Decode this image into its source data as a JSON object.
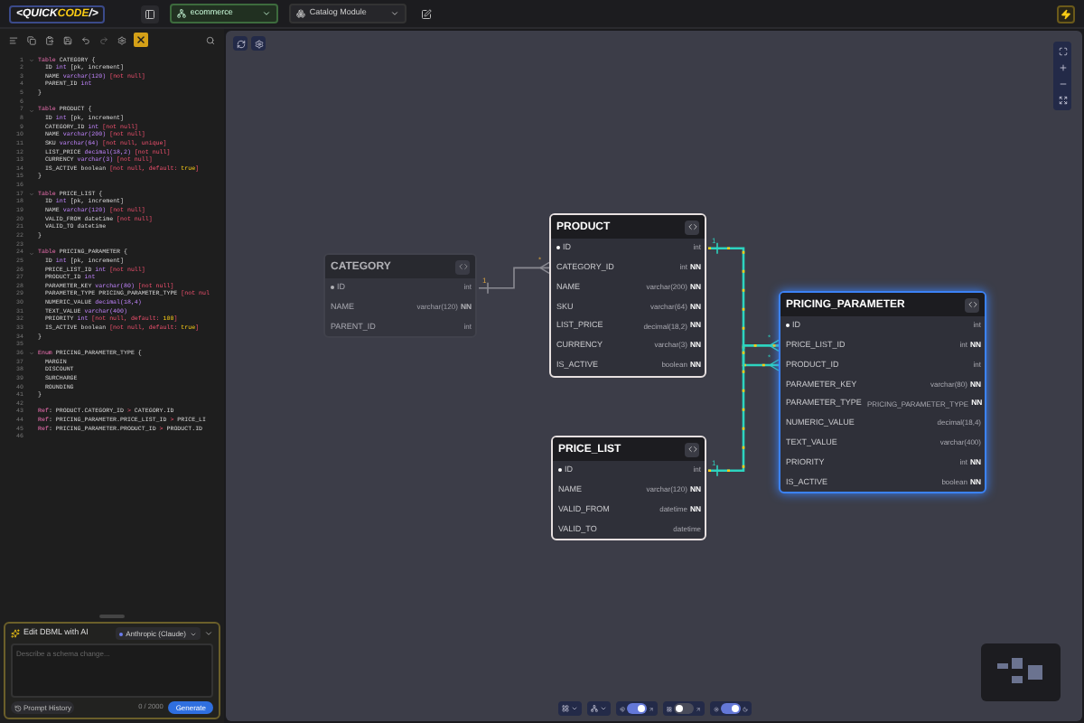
{
  "topbar": {
    "logo": [
      {
        "text": "<",
        "accent": false
      },
      {
        "text": "QUICK",
        "accent": false
      },
      {
        "text": "CODE",
        "accent": true
      },
      {
        "text": "/>",
        "accent": false
      }
    ],
    "project": {
      "value": "ecommerce"
    },
    "module": {
      "value": "Catalog Module"
    }
  },
  "editor": {
    "ai_active": true,
    "lines": [
      {
        "n": "1",
        "fold": true,
        "segs": [
          {
            "kind": "k",
            "text": "Table"
          },
          {
            "kind": "p",
            "text": " CATEGORY {"
          }
        ]
      },
      {
        "n": "2",
        "fold": false,
        "segs": [
          {
            "kind": "p",
            "text": "  ID "
          },
          {
            "kind": "t",
            "text": "int"
          },
          {
            "kind": "p",
            "text": " [pk, increment]"
          }
        ]
      },
      {
        "n": "3",
        "fold": false,
        "segs": [
          {
            "kind": "p",
            "text": "  NAME "
          },
          {
            "kind": "t",
            "text": "varchar(120)"
          },
          {
            "kind": "m",
            "text": " [not null]"
          }
        ]
      },
      {
        "n": "4",
        "fold": false,
        "segs": [
          {
            "kind": "p",
            "text": "  PARENT_ID "
          },
          {
            "kind": "t",
            "text": "int"
          }
        ]
      },
      {
        "n": "5",
        "fold": false,
        "segs": [
          {
            "kind": "p",
            "text": "}"
          }
        ]
      },
      {
        "n": "6",
        "fold": false
      },
      {
        "n": "7",
        "fold": true,
        "segs": [
          {
            "kind": "k",
            "text": "Table"
          },
          {
            "kind": "p",
            "text": " PRODUCT {"
          }
        ]
      },
      {
        "n": "8",
        "fold": false,
        "segs": [
          {
            "kind": "p",
            "text": "  ID "
          },
          {
            "kind": "t",
            "text": "int"
          },
          {
            "kind": "p",
            "text": " [pk, increment]"
          }
        ]
      },
      {
        "n": "9",
        "fold": false,
        "segs": [
          {
            "kind": "p",
            "text": "  CATEGORY_ID "
          },
          {
            "kind": "t",
            "text": "int"
          },
          {
            "kind": "m",
            "text": " [not null]"
          }
        ]
      },
      {
        "n": "10",
        "fold": false,
        "segs": [
          {
            "kind": "p",
            "text": "  NAME "
          },
          {
            "kind": "t",
            "text": "varchar(200)"
          },
          {
            "kind": "m",
            "text": " [not null]"
          }
        ]
      },
      {
        "n": "11",
        "fold": false,
        "segs": [
          {
            "kind": "p",
            "text": "  SKU "
          },
          {
            "kind": "t",
            "text": "varchar(64)"
          },
          {
            "kind": "m",
            "text": " [not null, unique]"
          }
        ]
      },
      {
        "n": "12",
        "fold": false,
        "segs": [
          {
            "kind": "p",
            "text": "  LIST_PRICE "
          },
          {
            "kind": "t",
            "text": "decimal(18,2)"
          },
          {
            "kind": "m",
            "text": " [not null]"
          }
        ]
      },
      {
        "n": "13",
        "fold": false,
        "segs": [
          {
            "kind": "p",
            "text": "  CURRENCY "
          },
          {
            "kind": "t",
            "text": "varchar(3)"
          },
          {
            "kind": "m",
            "text": " [not null]"
          }
        ]
      },
      {
        "n": "14",
        "fold": false,
        "segs": [
          {
            "kind": "p",
            "text": "  IS_ACTIVE boolean "
          },
          {
            "kind": "m",
            "text": "[not null, default: "
          },
          {
            "kind": "l",
            "text": "true"
          },
          {
            "kind": "m",
            "text": "]"
          }
        ]
      },
      {
        "n": "15",
        "fold": false,
        "segs": [
          {
            "kind": "p",
            "text": "}"
          }
        ]
      },
      {
        "n": "16",
        "fold": false
      },
      {
        "n": "17",
        "fold": true,
        "segs": [
          {
            "kind": "k",
            "text": "Table"
          },
          {
            "kind": "p",
            "text": " PRICE_LIST {"
          }
        ]
      },
      {
        "n": "18",
        "fold": false,
        "segs": [
          {
            "kind": "p",
            "text": "  ID "
          },
          {
            "kind": "t",
            "text": "int"
          },
          {
            "kind": "p",
            "text": " [pk, increment]"
          }
        ]
      },
      {
        "n": "19",
        "fold": false,
        "segs": [
          {
            "kind": "p",
            "text": "  NAME "
          },
          {
            "kind": "t",
            "text": "varchar(120)"
          },
          {
            "kind": "m",
            "text": " [not null]"
          }
        ]
      },
      {
        "n": "20",
        "fold": false,
        "segs": [
          {
            "kind": "p",
            "text": "  VALID_FROM datetime "
          },
          {
            "kind": "m",
            "text": "[not null]"
          }
        ]
      },
      {
        "n": "21",
        "fold": false,
        "segs": [
          {
            "kind": "p",
            "text": "  VALID_TO datetime"
          }
        ]
      },
      {
        "n": "22",
        "fold": false,
        "segs": [
          {
            "kind": "p",
            "text": "}"
          }
        ]
      },
      {
        "n": "23",
        "fold": false
      },
      {
        "n": "24",
        "fold": true,
        "segs": [
          {
            "kind": "k",
            "text": "Table"
          },
          {
            "kind": "p",
            "text": " PRICING_PARAMETER {"
          }
        ]
      },
      {
        "n": "25",
        "fold": false,
        "segs": [
          {
            "kind": "p",
            "text": "  ID "
          },
          {
            "kind": "t",
            "text": "int"
          },
          {
            "kind": "p",
            "text": " [pk, increment]"
          }
        ]
      },
      {
        "n": "26",
        "fold": false,
        "segs": [
          {
            "kind": "p",
            "text": "  PRICE_LIST_ID "
          },
          {
            "kind": "t",
            "text": "int"
          },
          {
            "kind": "m",
            "text": " [not null]"
          }
        ]
      },
      {
        "n": "27",
        "fold": false,
        "segs": [
          {
            "kind": "p",
            "text": "  PRODUCT_ID "
          },
          {
            "kind": "t",
            "text": "int"
          }
        ]
      },
      {
        "n": "28",
        "fold": false,
        "segs": [
          {
            "kind": "p",
            "text": "  PARAMETER_KEY "
          },
          {
            "kind": "t",
            "text": "varchar(80)"
          },
          {
            "kind": "m",
            "text": " [not null]"
          }
        ]
      },
      {
        "n": "29",
        "fold": false,
        "segs": [
          {
            "kind": "p",
            "text": "  PARAMETER_TYPE PRICING_PARAMETER_TYPE "
          },
          {
            "kind": "m",
            "text": "[not nul"
          }
        ]
      },
      {
        "n": "30",
        "fold": false,
        "segs": [
          {
            "kind": "p",
            "text": "  NUMERIC_VALUE "
          },
          {
            "kind": "t",
            "text": "decimal(18,4)"
          }
        ]
      },
      {
        "n": "31",
        "fold": false,
        "segs": [
          {
            "kind": "p",
            "text": "  TEXT_VALUE "
          },
          {
            "kind": "t",
            "text": "varchar(400)"
          }
        ]
      },
      {
        "n": "32",
        "fold": false,
        "segs": [
          {
            "kind": "p",
            "text": "  PRIORITY "
          },
          {
            "kind": "t",
            "text": "int"
          },
          {
            "kind": "m",
            "text": " [not null, default: "
          },
          {
            "kind": "l",
            "text": "100"
          },
          {
            "kind": "m",
            "text": "]"
          }
        ]
      },
      {
        "n": "33",
        "fold": false,
        "segs": [
          {
            "kind": "p",
            "text": "  IS_ACTIVE boolean "
          },
          {
            "kind": "m",
            "text": "[not null, default: "
          },
          {
            "kind": "l",
            "text": "true"
          },
          {
            "kind": "m",
            "text": "]"
          }
        ]
      },
      {
        "n": "34",
        "fold": false,
        "segs": [
          {
            "kind": "p",
            "text": "}"
          }
        ]
      },
      {
        "n": "35",
        "fold": false
      },
      {
        "n": "36",
        "fold": true,
        "segs": [
          {
            "kind": "k",
            "text": "Enum"
          },
          {
            "kind": "p",
            "text": " PRICING_PARAMETER_TYPE {"
          }
        ]
      },
      {
        "n": "37",
        "fold": false,
        "segs": [
          {
            "kind": "p",
            "text": "  MARGIN"
          }
        ]
      },
      {
        "n": "38",
        "fold": false,
        "segs": [
          {
            "kind": "p",
            "text": "  DISCOUNT"
          }
        ]
      },
      {
        "n": "39",
        "fold": false,
        "segs": [
          {
            "kind": "p",
            "text": "  SURCHARGE"
          }
        ]
      },
      {
        "n": "40",
        "fold": false,
        "segs": [
          {
            "kind": "p",
            "text": "  ROUNDING"
          }
        ]
      },
      {
        "n": "41",
        "fold": false,
        "segs": [
          {
            "kind": "p",
            "text": "}"
          }
        ]
      },
      {
        "n": "42",
        "fold": false
      },
      {
        "n": "43",
        "fold": false,
        "segs": [
          {
            "kind": "k",
            "text": "Ref"
          },
          {
            "kind": "p",
            "text": ": PRODUCT.CATEGORY_ID "
          },
          {
            "kind": "m",
            "text": ">"
          },
          {
            "kind": "p",
            "text": " CATEGORY.ID"
          }
        ]
      },
      {
        "n": "44",
        "fold": false,
        "segs": [
          {
            "kind": "k",
            "text": "Ref"
          },
          {
            "kind": "p",
            "text": ": PRICING_PARAMETER.PRICE_LIST_ID "
          },
          {
            "kind": "m",
            "text": ">"
          },
          {
            "kind": "p",
            "text": " PRICE_LI"
          }
        ]
      },
      {
        "n": "45",
        "fold": false,
        "segs": [
          {
            "kind": "k",
            "text": "Ref"
          },
          {
            "kind": "p",
            "text": ": PRICING_PARAMETER.PRODUCT_ID "
          },
          {
            "kind": "m",
            "text": ">"
          },
          {
            "kind": "p",
            "text": " PRODUCT.ID"
          }
        ]
      },
      {
        "n": "46",
        "fold": false
      }
    ]
  },
  "ai_panel": {
    "title": "Edit DBML with AI",
    "provider": "Anthropic (Claude)",
    "placeholder": "Describe a schema change...",
    "history_button": "Prompt History",
    "counter": "0 / 2000",
    "generate_button": "Generate"
  },
  "canvas": {
    "tables": [
      {
        "name": "CATEGORY",
        "dimmed": true,
        "selected": false,
        "columns": [
          {
            "name": "ID",
            "type": "int",
            "pk": true
          },
          {
            "name": "NAME",
            "type": "varchar(120)",
            "flag": "NN",
            "pk": false
          },
          {
            "name": "PARENT_ID",
            "type": "int",
            "pk": false
          }
        ]
      },
      {
        "name": "PRODUCT",
        "dimmed": false,
        "selected": false,
        "columns": [
          {
            "name": "ID",
            "type": "int",
            "pk": true
          },
          {
            "name": "CATEGORY_ID",
            "type": "int",
            "flag": "NN",
            "pk": false
          },
          {
            "name": "NAME",
            "type": "varchar(200)",
            "flag": "NN",
            "pk": false
          },
          {
            "name": "SKU",
            "type": "varchar(64)",
            "flag": "NN",
            "pk": false
          },
          {
            "name": "LIST_PRICE",
            "type": "decimal(18,2)",
            "flag": "NN",
            "pk": false
          },
          {
            "name": "CURRENCY",
            "type": "varchar(3)",
            "flag": "NN",
            "pk": false
          },
          {
            "name": "IS_ACTIVE",
            "type": "boolean",
            "flag": "NN",
            "pk": false
          }
        ]
      },
      {
        "name": "PRICE_LIST",
        "dimmed": false,
        "selected": false,
        "columns": [
          {
            "name": "ID",
            "type": "int",
            "pk": true
          },
          {
            "name": "NAME",
            "type": "varchar(120)",
            "flag": "NN",
            "pk": false
          },
          {
            "name": "VALID_FROM",
            "type": "datetime",
            "flag": "NN",
            "pk": false
          },
          {
            "name": "VALID_TO",
            "type": "datetime",
            "pk": false
          }
        ]
      },
      {
        "name": "PRICING_PARAMETER",
        "dimmed": false,
        "selected": true,
        "columns": [
          {
            "name": "ID",
            "type": "int",
            "pk": true
          },
          {
            "name": "PRICE_LIST_ID",
            "type": "int",
            "flag": "NN",
            "pk": false
          },
          {
            "name": "PRODUCT_ID",
            "type": "int",
            "pk": false
          },
          {
            "name": "PARAMETER_KEY",
            "type": "varchar(80)",
            "flag": "NN",
            "pk": false
          },
          {
            "name": "PARAMETER_TYPE",
            "type": "PRICING_PARAMETER_TYPE",
            "flag": "NN",
            "pk": false
          },
          {
            "name": "NUMERIC_VALUE",
            "type": "decimal(18,4)",
            "pk": false
          },
          {
            "name": "TEXT_VALUE",
            "type": "varchar(400)",
            "pk": false
          },
          {
            "name": "PRIORITY",
            "type": "int",
            "flag": "NN",
            "pk": false
          },
          {
            "name": "IS_ACTIVE",
            "type": "boolean",
            "flag": "NN",
            "pk": false
          }
        ]
      }
    ],
    "relations": [
      {
        "one_label": "1",
        "many_label": "*",
        "highlighted": false
      },
      {
        "one_label": "1",
        "many_label": "*",
        "highlighted": true
      },
      {
        "one_label": "1",
        "many_label": "*",
        "highlighted": true
      }
    ],
    "toggles": [
      {
        "on": true
      },
      {
        "on": false
      },
      {
        "on": true
      }
    ]
  }
}
